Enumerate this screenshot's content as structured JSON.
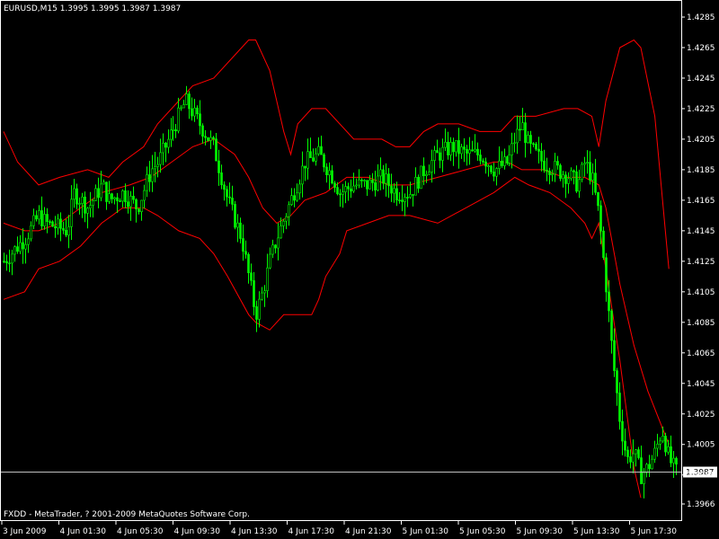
{
  "header": {
    "symbol_info": "EURUSD,M15  1.3995 1.3995 1.3987 1.3987"
  },
  "footer": {
    "copyright": "FXDD - MetaTrader, ? 2001-2009 MetaQuotes Software Corp."
  },
  "colors": {
    "background": "#000000",
    "candle": "#00ff00",
    "bands": "#ff0000",
    "frame": "#ffffff",
    "bid_line": "#c0c0c0"
  },
  "chart_data": {
    "type": "candlestick",
    "symbol": "EURUSD",
    "timeframe": "M15",
    "ohlc": {
      "open": 1.3995,
      "high": 1.3995,
      "low": 1.3987,
      "close": 1.3987
    },
    "bid_price": "1.3987",
    "ylim": [
      1.3956,
      1.4295
    ],
    "y_ticks": [
      "1.4285",
      "1.4265",
      "1.4245",
      "1.4225",
      "1.4205",
      "1.4185",
      "1.4165",
      "1.4145",
      "1.4125",
      "1.4105",
      "1.4085",
      "1.4065",
      "1.4045",
      "1.4025",
      "1.4005",
      "1.3985",
      "1.3966"
    ],
    "x_ticks": [
      "3 Jun 2009",
      "4 Jun 01:30",
      "4 Jun 05:30",
      "4 Jun 09:30",
      "4 Jun 13:30",
      "4 Jun 17:30",
      "4 Jun 21:30",
      "5 Jun 01:30",
      "5 Jun 05:30",
      "5 Jun 09:30",
      "5 Jun 13:30",
      "5 Jun 17:30"
    ],
    "close_path": [
      [
        0,
        1.4125
      ],
      [
        3,
        1.414
      ],
      [
        5,
        1.4155
      ],
      [
        6,
        1.415
      ],
      [
        9,
        1.4145
      ],
      [
        10,
        1.417
      ],
      [
        12,
        1.416
      ],
      [
        14,
        1.4175
      ],
      [
        15,
        1.4165
      ],
      [
        17,
        1.417
      ],
      [
        19,
        1.416
      ],
      [
        21,
        1.4185
      ],
      [
        22,
        1.419
      ],
      [
        24,
        1.421
      ],
      [
        26,
        1.423
      ],
      [
        28,
        1.4215
      ],
      [
        30,
        1.42
      ],
      [
        32,
        1.4165
      ],
      [
        34,
        1.414
      ],
      [
        35,
        1.4115
      ],
      [
        36,
        1.409
      ],
      [
        37,
        1.4105
      ],
      [
        38,
        1.4125
      ],
      [
        39,
        1.414
      ],
      [
        41,
        1.4165
      ],
      [
        43,
        1.419
      ],
      [
        45,
        1.4195
      ],
      [
        47,
        1.418
      ],
      [
        48,
        1.417
      ],
      [
        50,
        1.4175
      ],
      [
        52,
        1.4175
      ],
      [
        54,
        1.418
      ],
      [
        56,
        1.417
      ],
      [
        58,
        1.417
      ],
      [
        60,
        1.4185
      ],
      [
        62,
        1.4195
      ],
      [
        64,
        1.42
      ],
      [
        66,
        1.4195
      ],
      [
        68,
        1.4195
      ],
      [
        70,
        1.4185
      ],
      [
        72,
        1.419
      ],
      [
        73,
        1.4205
      ],
      [
        74,
        1.4215
      ],
      [
        75,
        1.42
      ],
      [
        77,
        1.419
      ],
      [
        79,
        1.4185
      ],
      [
        81,
        1.418
      ],
      [
        82,
        1.4175
      ],
      [
        83,
        1.419
      ],
      [
        84,
        1.418
      ],
      [
        85,
        1.4155
      ],
      [
        86,
        1.411
      ],
      [
        87,
        1.406
      ],
      [
        88,
        1.402
      ],
      [
        89,
        1.3995
      ],
      [
        90,
        1.4
      ],
      [
        91,
        1.3985
      ],
      [
        92,
        1.399
      ],
      [
        93,
        1.4
      ],
      [
        94,
        1.4015
      ],
      [
        95,
        1.3995
      ],
      [
        96,
        1.3987
      ]
    ],
    "upper_band": [
      [
        0,
        1.421
      ],
      [
        2,
        1.419
      ],
      [
        5,
        1.4175
      ],
      [
        8,
        1.418
      ],
      [
        12,
        1.4185
      ],
      [
        15,
        1.418
      ],
      [
        17,
        1.419
      ],
      [
        20,
        1.42
      ],
      [
        22,
        1.4215
      ],
      [
        25,
        1.423
      ],
      [
        27,
        1.424
      ],
      [
        30,
        1.4245
      ],
      [
        33,
        1.426
      ],
      [
        35,
        1.427
      ],
      [
        36,
        1.427
      ],
      [
        38,
        1.425
      ],
      [
        40,
        1.421
      ],
      [
        41,
        1.4195
      ],
      [
        42,
        1.4215
      ],
      [
        44,
        1.4225
      ],
      [
        46,
        1.4225
      ],
      [
        48,
        1.4215
      ],
      [
        50,
        1.4205
      ],
      [
        52,
        1.4205
      ],
      [
        54,
        1.4205
      ],
      [
        56,
        1.42
      ],
      [
        58,
        1.42
      ],
      [
        60,
        1.421
      ],
      [
        62,
        1.4215
      ],
      [
        65,
        1.4215
      ],
      [
        68,
        1.421
      ],
      [
        71,
        1.421
      ],
      [
        73,
        1.422
      ],
      [
        76,
        1.422
      ],
      [
        80,
        1.4225
      ],
      [
        82,
        1.4225
      ],
      [
        84,
        1.422
      ],
      [
        85,
        1.42
      ],
      [
        86,
        1.423
      ],
      [
        88,
        1.4265
      ],
      [
        90,
        1.427
      ],
      [
        91,
        1.4265
      ],
      [
        93,
        1.422
      ],
      [
        95,
        1.412
      ]
    ],
    "middle_band": [
      [
        0,
        1.415
      ],
      [
        3,
        1.4145
      ],
      [
        5,
        1.4145
      ],
      [
        8,
        1.415
      ],
      [
        11,
        1.416
      ],
      [
        14,
        1.417
      ],
      [
        18,
        1.4175
      ],
      [
        21,
        1.418
      ],
      [
        24,
        1.419
      ],
      [
        27,
        1.42
      ],
      [
        30,
        1.4205
      ],
      [
        33,
        1.4195
      ],
      [
        35,
        1.418
      ],
      [
        37,
        1.416
      ],
      [
        39,
        1.415
      ],
      [
        41,
        1.4155
      ],
      [
        43,
        1.4165
      ],
      [
        46,
        1.417
      ],
      [
        49,
        1.418
      ],
      [
        52,
        1.418
      ],
      [
        55,
        1.4175
      ],
      [
        58,
        1.4175
      ],
      [
        62,
        1.418
      ],
      [
        66,
        1.4185
      ],
      [
        70,
        1.419
      ],
      [
        72,
        1.419
      ],
      [
        74,
        1.4185
      ],
      [
        77,
        1.4185
      ],
      [
        80,
        1.418
      ],
      [
        83,
        1.418
      ],
      [
        85,
        1.4175
      ],
      [
        86,
        1.416
      ],
      [
        88,
        1.411
      ],
      [
        90,
        1.407
      ],
      [
        92,
        1.404
      ],
      [
        95,
        1.4005
      ]
    ],
    "lower_band": [
      [
        0,
        1.41
      ],
      [
        3,
        1.4105
      ],
      [
        5,
        1.412
      ],
      [
        8,
        1.4125
      ],
      [
        11,
        1.4135
      ],
      [
        14,
        1.415
      ],
      [
        17,
        1.416
      ],
      [
        20,
        1.416
      ],
      [
        22,
        1.4155
      ],
      [
        25,
        1.4145
      ],
      [
        28,
        1.414
      ],
      [
        30,
        1.413
      ],
      [
        32,
        1.4115
      ],
      [
        35,
        1.409
      ],
      [
        36,
        1.4085
      ],
      [
        38,
        1.408
      ],
      [
        40,
        1.409
      ],
      [
        42,
        1.409
      ],
      [
        44,
        1.409
      ],
      [
        45,
        1.41
      ],
      [
        46,
        1.4115
      ],
      [
        48,
        1.413
      ],
      [
        49,
        1.4145
      ],
      [
        52,
        1.415
      ],
      [
        55,
        1.4155
      ],
      [
        58,
        1.4155
      ],
      [
        62,
        1.415
      ],
      [
        66,
        1.416
      ],
      [
        70,
        1.417
      ],
      [
        73,
        1.418
      ],
      [
        75,
        1.4175
      ],
      [
        78,
        1.417
      ],
      [
        81,
        1.416
      ],
      [
        83,
        1.415
      ],
      [
        84,
        1.414
      ],
      [
        85,
        1.415
      ],
      [
        86,
        1.412
      ],
      [
        88,
        1.406
      ],
      [
        90,
        1.399
      ],
      [
        91,
        1.397
      ]
    ],
    "grid": false,
    "legend": "none"
  }
}
